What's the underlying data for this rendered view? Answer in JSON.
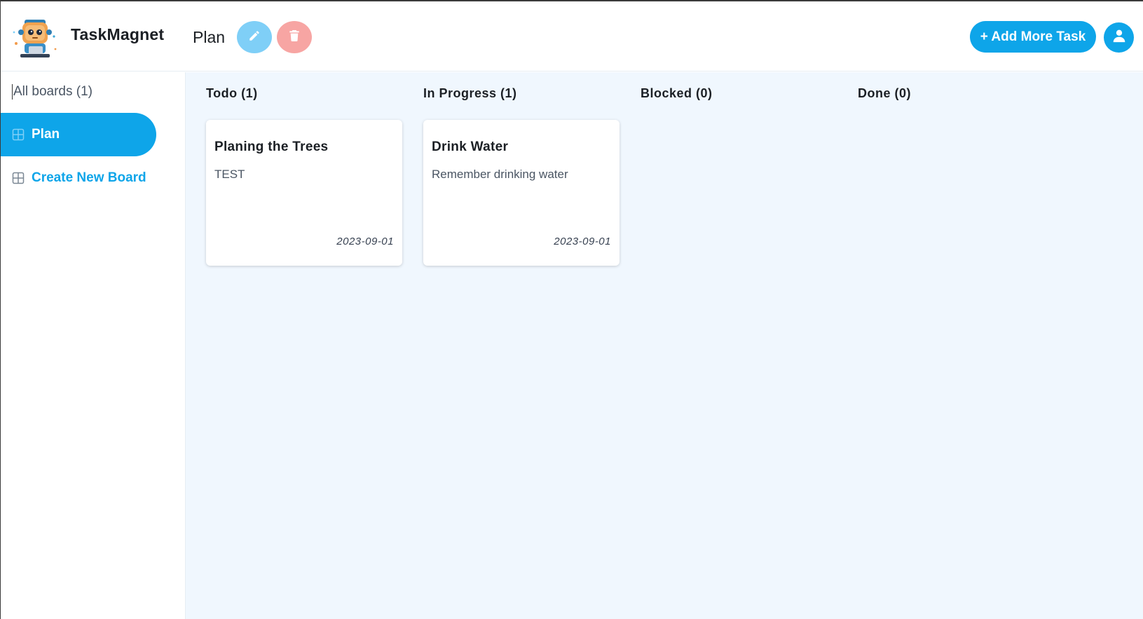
{
  "app": {
    "brand": "TaskMagnet",
    "logo_icon": "robot-mascot-icon"
  },
  "header": {
    "board_title": "Plan",
    "edit_icon": "pencil-icon",
    "delete_icon": "trash-icon",
    "add_task_label": "+ Add More Task",
    "avatar_icon": "user-icon"
  },
  "sidebar": {
    "all_boards_label": "All boards (1)",
    "items": [
      {
        "label": "Plan",
        "icon": "board-icon",
        "active": true
      },
      {
        "label": "Create New Board",
        "icon": "board-icon",
        "active": false
      }
    ]
  },
  "columns": [
    {
      "title": "Todo (1)",
      "cards": [
        {
          "title": "Planing the Trees",
          "description": "TEST",
          "date": "2023-09-01"
        }
      ]
    },
    {
      "title": "In Progress (1)",
      "cards": [
        {
          "title": "Drink Water",
          "description": "Remember drinking water",
          "date": "2023-09-01"
        }
      ]
    },
    {
      "title": "Blocked (0)",
      "cards": []
    },
    {
      "title": "Done (0)",
      "cards": []
    }
  ],
  "colors": {
    "accent": "#0ea5e9",
    "edit": "#7fcff7",
    "delete": "#f7a5a3",
    "board_bg": "#f0f7fe"
  }
}
